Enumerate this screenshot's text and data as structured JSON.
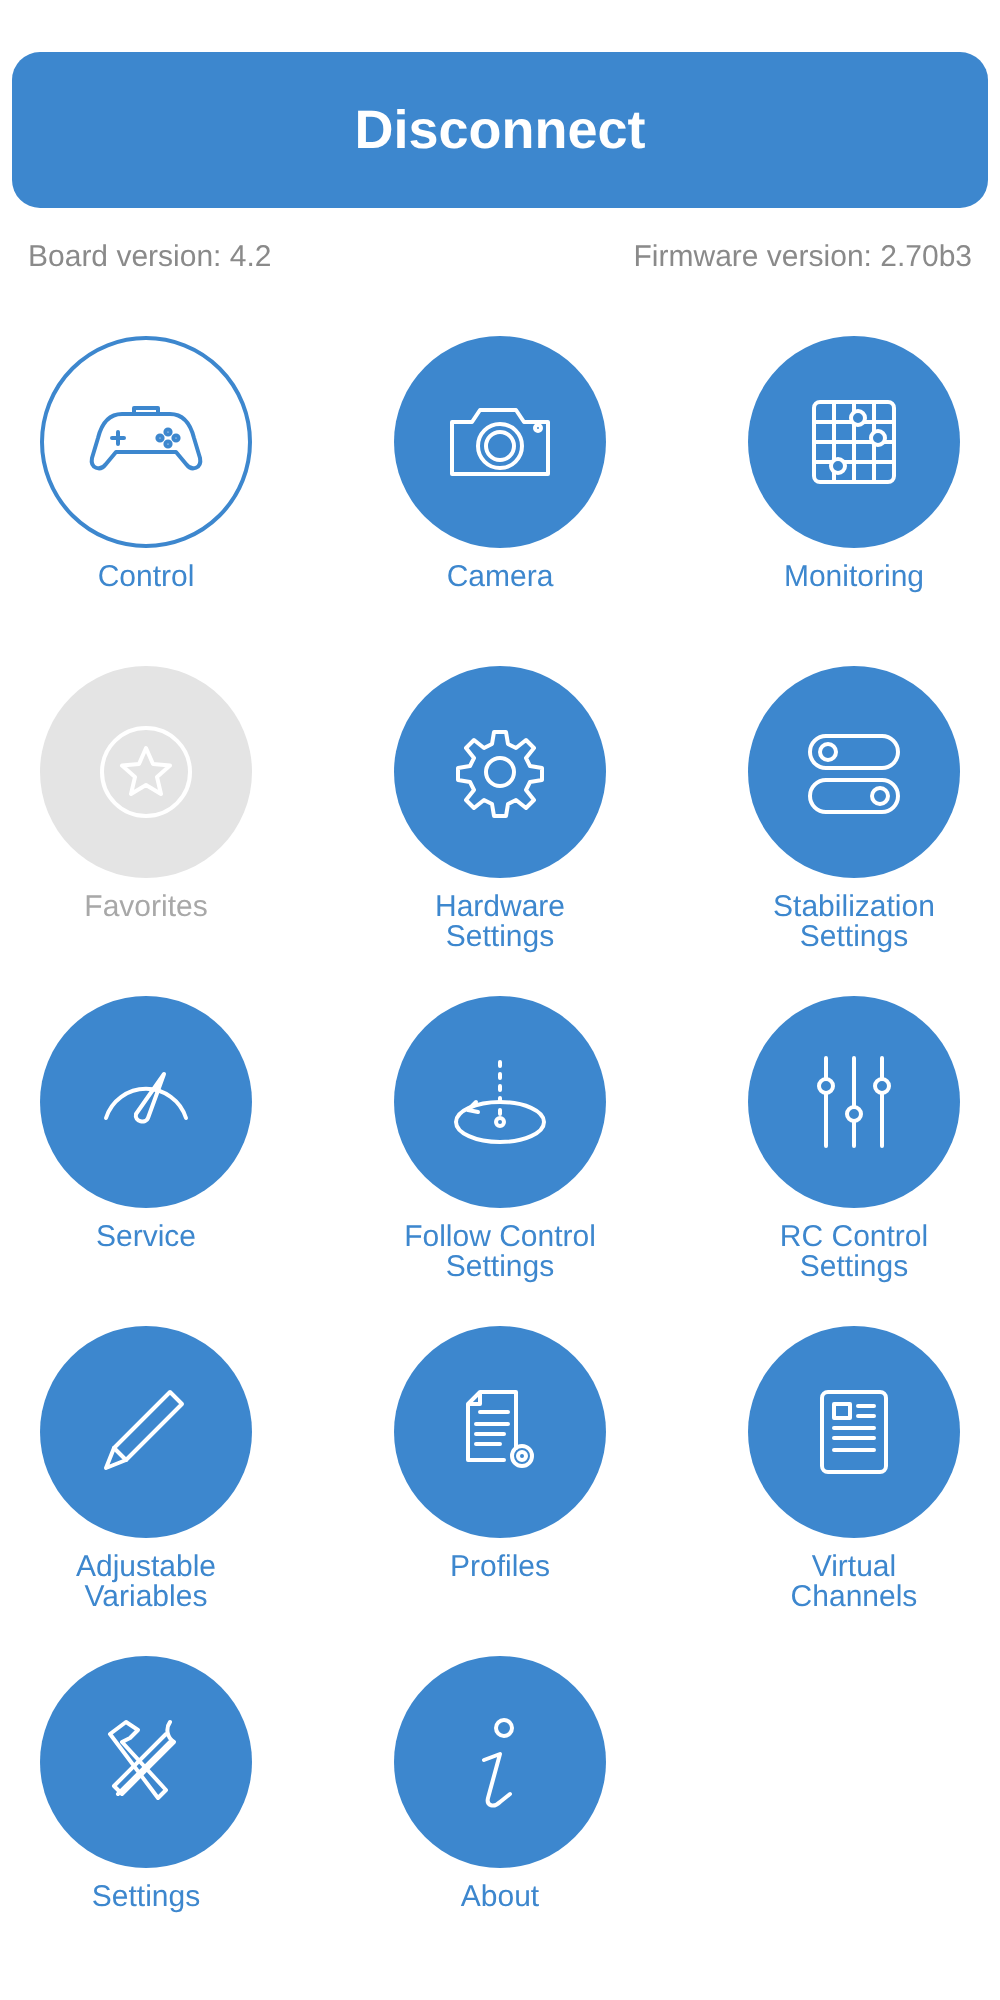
{
  "disconnect_button": {
    "label": "Disconnect"
  },
  "board_version": "Board version: 4.2",
  "firmware_version": "Firmware version: 2.70b3",
  "menu": [
    {
      "label": "Control",
      "selected": true,
      "disabled": false
    },
    {
      "label": "Camera",
      "selected": false,
      "disabled": false
    },
    {
      "label": "Monitoring",
      "selected": false,
      "disabled": false
    },
    {
      "label": "Favorites",
      "selected": false,
      "disabled": true
    },
    {
      "label": "Hardware\nSettings",
      "selected": false,
      "disabled": false
    },
    {
      "label": "Stabilization\nSettings",
      "selected": false,
      "disabled": false
    },
    {
      "label": "Service",
      "selected": false,
      "disabled": false
    },
    {
      "label": "Follow Control\nSettings",
      "selected": false,
      "disabled": false
    },
    {
      "label": "RC Control\nSettings",
      "selected": false,
      "disabled": false
    },
    {
      "label": "Adjustable\nVariables",
      "selected": false,
      "disabled": false
    },
    {
      "label": "Profiles",
      "selected": false,
      "disabled": false
    },
    {
      "label": "Virtual\nChannels",
      "selected": false,
      "disabled": false
    },
    {
      "label": "Settings",
      "selected": false,
      "disabled": false
    },
    {
      "label": "About",
      "selected": false,
      "disabled": false
    }
  ]
}
